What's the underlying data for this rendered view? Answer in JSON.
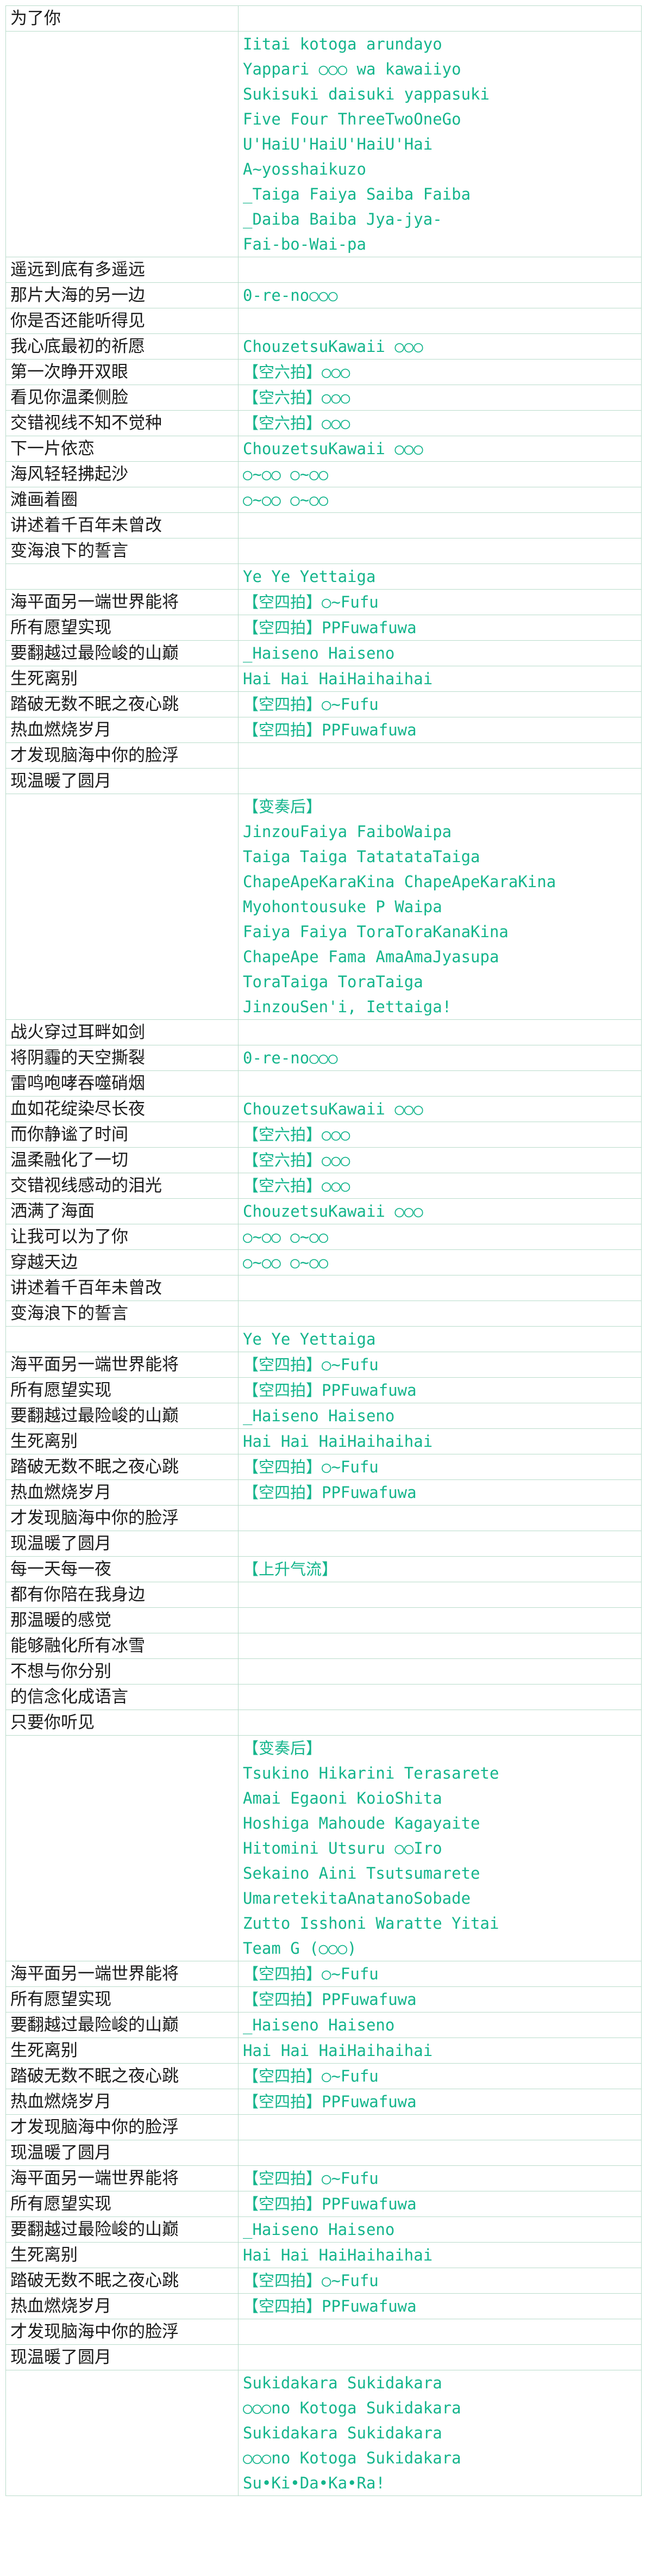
{
  "rows": [
    {
      "left": "为了你",
      "right": []
    },
    {
      "left": "",
      "right": [
        "Iitai kotoga arundayo",
        "Yappari ○○○ wa kawaiiyo",
        "Sukisuki daisuki yappasuki",
        "Five Four ThreeTwoOneGo",
        "U'HaiU'HaiU'HaiU'Hai",
        "A~yosshaikuzo",
        "_Taiga Faiya Saiba Faiba",
        "_Daiba Baiba Jya-jya-",
        "Fai-bo-Wai-pa"
      ]
    },
    {
      "left": "遥远到底有多遥远",
      "right": []
    },
    {
      "left": "那片大海的另一边",
      "right": [
        "0-re-no○○○"
      ]
    },
    {
      "left": "你是否还能听得见",
      "right": []
    },
    {
      "left": "我心底最初的祈愿",
      "right": [
        "ChouzetsuKawaii ○○○"
      ]
    },
    {
      "left": "第一次睁开双眼",
      "right": [
        "【空六拍】○○○"
      ]
    },
    {
      "left": "看见你温柔侧脸",
      "right": [
        "【空六拍】○○○"
      ]
    },
    {
      "left": "交错视线不知不觉种",
      "right": [
        "【空六拍】○○○"
      ]
    },
    {
      "left": "下一片依恋",
      "right": [
        "ChouzetsuKawaii ○○○"
      ]
    },
    {
      "left": "海风轻轻拂起沙",
      "right": [
        "○~○○ ○~○○"
      ]
    },
    {
      "left": "滩画着圈",
      "right": [
        "○~○○ ○~○○"
      ]
    },
    {
      "left": "讲述着千百年未曾改",
      "right": []
    },
    {
      "left": "变海浪下的誓言",
      "right": []
    },
    {
      "left": "",
      "right": [
        "Ye Ye Yettaiga"
      ]
    },
    {
      "left": "海平面另一端世界能将",
      "right": [
        "【空四拍】○~Fufu"
      ]
    },
    {
      "left": "所有愿望实现",
      "right": [
        "【空四拍】PPFuwafuwa"
      ]
    },
    {
      "left": "要翻越过最险峻的山巅",
      "right": [
        "_Haiseno Haiseno"
      ]
    },
    {
      "left": "生死离别",
      "right": [
        "Hai Hai HaiHaihaihai"
      ]
    },
    {
      "left": "踏破无数不眠之夜心跳",
      "right": [
        "【空四拍】○~Fufu"
      ]
    },
    {
      "left": "热血燃烧岁月",
      "right": [
        "【空四拍】PPFuwafuwa"
      ]
    },
    {
      "left": "才发现脑海中你的脸浮",
      "right": []
    },
    {
      "left": "现温暖了圆月",
      "right": []
    },
    {
      "left": "",
      "right": [
        "【变奏后】",
        "JinzouFaiya FaiboWaipa",
        "Taiga Taiga TatatataTaiga",
        "ChapeApeKaraKina ChapeApeKaraKina",
        "Myohontousuke P Waipa",
        "Faiya Faiya ToraToraKanaKina",
        "ChapeApe Fama AmaAmaJyasupa",
        "ToraTaiga ToraTaiga",
        "JinzouSen'i, Iettaiga!"
      ]
    },
    {
      "left": "战火穿过耳畔如剑",
      "right": []
    },
    {
      "left": "将阴霾的天空撕裂",
      "right": [
        "0-re-no○○○"
      ]
    },
    {
      "left": "雷鸣咆哮吞噬硝烟",
      "right": []
    },
    {
      "left": "血如花绽染尽长夜",
      "right": [
        "ChouzetsuKawaii ○○○"
      ]
    },
    {
      "left": "而你静谧了时间",
      "right": [
        "【空六拍】○○○"
      ]
    },
    {
      "left": "温柔融化了一切",
      "right": [
        "【空六拍】○○○"
      ]
    },
    {
      "left": "交错视线感动的泪光",
      "right": [
        "【空六拍】○○○"
      ]
    },
    {
      "left": "洒满了海面",
      "right": [
        "ChouzetsuKawaii ○○○"
      ]
    },
    {
      "left": "让我可以为了你",
      "right": [
        "○~○○ ○~○○"
      ]
    },
    {
      "left": "穿越天边",
      "right": [
        "○~○○ ○~○○"
      ]
    },
    {
      "left": "讲述着千百年未曾改",
      "right": []
    },
    {
      "left": "变海浪下的誓言",
      "right": []
    },
    {
      "left": "",
      "right": [
        "Ye Ye Yettaiga"
      ]
    },
    {
      "left": "海平面另一端世界能将",
      "right": [
        "【空四拍】○~Fufu"
      ]
    },
    {
      "left": "所有愿望实现",
      "right": [
        "【空四拍】PPFuwafuwa"
      ]
    },
    {
      "left": "要翻越过最险峻的山巅",
      "right": [
        "_Haiseno Haiseno"
      ]
    },
    {
      "left": "生死离别",
      "right": [
        "Hai Hai HaiHaihaihai"
      ]
    },
    {
      "left": "踏破无数不眠之夜心跳",
      "right": [
        "【空四拍】○~Fufu"
      ]
    },
    {
      "left": "热血燃烧岁月",
      "right": [
        "【空四拍】PPFuwafuwa"
      ]
    },
    {
      "left": "才发现脑海中你的脸浮",
      "right": []
    },
    {
      "left": "现温暖了圆月",
      "right": []
    },
    {
      "left": "每一天每一夜",
      "right": [
        "【上升气流】"
      ]
    },
    {
      "left": "都有你陪在我身边",
      "right": []
    },
    {
      "left": "那温暖的感觉",
      "right": []
    },
    {
      "left": "能够融化所有冰雪",
      "right": []
    },
    {
      "left": "不想与你分别",
      "right": []
    },
    {
      "left": "的信念化成语言",
      "right": []
    },
    {
      "left": "只要你听见",
      "right": []
    },
    {
      "left": "",
      "right": [
        "【变奏后】",
        "Tsukino Hikarini Terasarete",
        "Amai Egaoni KoioShita",
        "Hoshiga Mahoude Kagayaite",
        "Hitomini Utsuru ○○Iro",
        "Sekaino Aini Tsutsumarete",
        "UmaretekitaAnatanoSobade",
        "Zutto Isshoni Waratte Yitai",
        "Team G (○○○)"
      ]
    },
    {
      "left": "海平面另一端世界能将",
      "right": [
        "【空四拍】○~Fufu"
      ]
    },
    {
      "left": "所有愿望实现",
      "right": [
        "【空四拍】PPFuwafuwa"
      ]
    },
    {
      "left": "要翻越过最险峻的山巅",
      "right": [
        "_Haiseno Haiseno"
      ]
    },
    {
      "left": "生死离别",
      "right": [
        "Hai Hai HaiHaihaihai"
      ]
    },
    {
      "left": "踏破无数不眠之夜心跳",
      "right": [
        "【空四拍】○~Fufu"
      ]
    },
    {
      "left": "热血燃烧岁月",
      "right": [
        "【空四拍】PPFuwafuwa"
      ]
    },
    {
      "left": "才发现脑海中你的脸浮",
      "right": []
    },
    {
      "left": "现温暖了圆月",
      "right": []
    },
    {
      "left": "海平面另一端世界能将",
      "right": [
        "【空四拍】○~Fufu"
      ]
    },
    {
      "left": "所有愿望实现",
      "right": [
        "【空四拍】PPFuwafuwa"
      ]
    },
    {
      "left": "要翻越过最险峻的山巅",
      "right": [
        "_Haiseno Haiseno"
      ]
    },
    {
      "left": "生死离别",
      "right": [
        "Hai Hai HaiHaihaihai"
      ]
    },
    {
      "left": "踏破无数不眠之夜心跳",
      "right": [
        "【空四拍】○~Fufu"
      ]
    },
    {
      "left": "热血燃烧岁月",
      "right": [
        "【空四拍】PPFuwafuwa"
      ]
    },
    {
      "left": "才发现脑海中你的脸浮",
      "right": []
    },
    {
      "left": "现温暖了圆月",
      "right": []
    },
    {
      "left": "",
      "right": [
        "Sukidakara Sukidakara",
        "○○○no Kotoga Sukidakara",
        "Sukidakara Sukidakara",
        "○○○no Kotoga Sukidakara",
        "Su•Ki•Da•Ka•Ra!"
      ]
    }
  ]
}
